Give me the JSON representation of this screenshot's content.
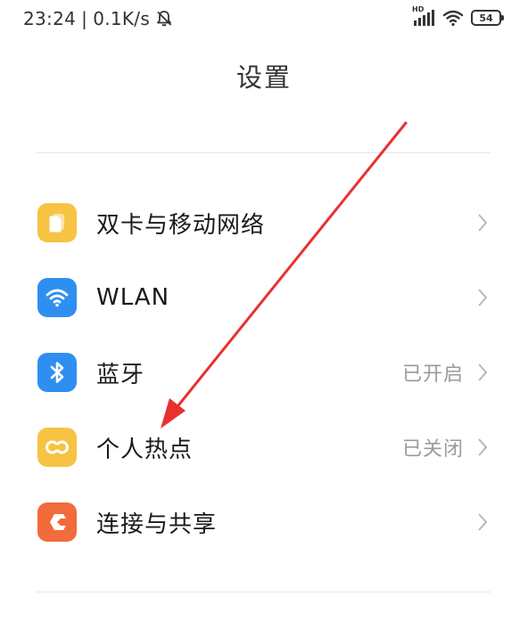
{
  "status_bar": {
    "time": "23:24",
    "separator": "|",
    "speed": "0.1K/s",
    "network_badge": "HD",
    "battery": "54",
    "icons": [
      "bell-off-icon",
      "signal-icon",
      "wifi-icon",
      "battery-icon"
    ]
  },
  "header": {
    "title": "设置"
  },
  "settings": {
    "items": [
      {
        "label": "双卡与移动网络",
        "value": "",
        "icon": "sim-card-icon",
        "color": "#F6C343"
      },
      {
        "label": "WLAN",
        "value": "",
        "icon": "wifi-icon",
        "color": "#2F8FF0"
      },
      {
        "label": "蓝牙",
        "value": "已开启",
        "icon": "bluetooth-icon",
        "color": "#2F8FF0"
      },
      {
        "label": "个人热点",
        "value": "已关闭",
        "icon": "hotspot-icon",
        "color": "#F6C343"
      },
      {
        "label": "连接与共享",
        "value": "",
        "icon": "connection-share-icon",
        "color": "#F26B3A"
      }
    ]
  },
  "annotation": {
    "arrow_color": "#E8312F"
  }
}
